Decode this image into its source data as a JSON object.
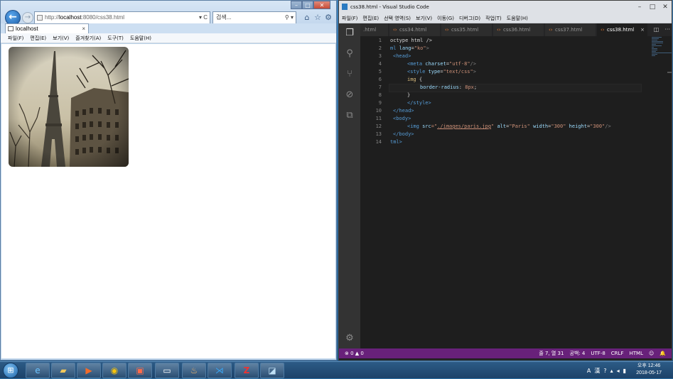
{
  "ie": {
    "address_prefix": "http://",
    "address_host": "localhost",
    "address_suffix": ":8080/css38.html",
    "address_ctrls": "▾ C",
    "search_placeholder": "검색...",
    "search_ctrls": "⚲ ▾",
    "tab_title": "localhost",
    "tab_close": "×",
    "ghost_tab": "",
    "menu": [
      "파일(F)",
      "편집(E)",
      "보기(V)",
      "즐겨찾기(A)",
      "도구(T)",
      "도움말(H)"
    ],
    "image_alt": "Paris"
  },
  "vscode": {
    "title": "css38.html - Visual Studio Code",
    "menu": [
      "파일(F)",
      "편집(E)",
      "선택 영역(S)",
      "보기(V)",
      "이동(G)",
      "디버그(D)",
      "작업(T)",
      "도움말(H)"
    ],
    "tabs": [
      {
        "label": ".html",
        "active": false
      },
      {
        "label": "css34.html",
        "active": false
      },
      {
        "label": "css35.html",
        "active": false
      },
      {
        "label": "css36.html",
        "active": false
      },
      {
        "label": "css37.html",
        "active": false
      },
      {
        "label": "css38.html",
        "active": true
      }
    ],
    "tab_close": "×",
    "line_numbers": [
      "1",
      "2",
      "3",
      "4",
      "5",
      "6",
      "7",
      "8",
      "9",
      "10",
      "11",
      "12",
      "13",
      "14"
    ],
    "status_left": "⊗ 0 ▲ 0",
    "status_right": [
      "줄 7, 열 31",
      "공백: 4",
      "UTF-8",
      "CRLF",
      "HTML",
      "☺",
      "🔔"
    ]
  },
  "code": {
    "l1": "octype html />",
    "l2a": "ml ",
    "l2b": "lang",
    "l2c": "=",
    "l2d": "\"ko\"",
    "l2e": ">",
    "l3": "<head>",
    "l4a": "<meta ",
    "l4b": "charset",
    "l4c": "=",
    "l4d": "\"utf-8\"",
    "l4e": "/>",
    "l5a": "<style ",
    "l5b": "type",
    "l5c": "=",
    "l5d": "\"text/css\"",
    "l5e": ">",
    "l6a": "img",
    "l6b": " {",
    "l7a": "border-radius",
    "l7b": ": ",
    "l7c": "8px",
    "l7d": ";",
    "l8": "}",
    "l9": "</style>",
    "l10": "</head>",
    "l11": "<body>",
    "l12a": "<img ",
    "l12b": "src",
    "l12c": "=\"",
    "l12d": "./images/paris.jpg",
    "l12e": "\" ",
    "l12f": "alt",
    "l12g": "=",
    "l12h": "\"Paris\" ",
    "l12i": "width",
    "l12j": "=",
    "l12k": "\"300\" ",
    "l12l": "height",
    "l12m": "=",
    "l12n": "\"300\"",
    "l12o": "/>",
    "l13": "</body>",
    "l14": "tml>"
  },
  "taskbar": {
    "clock_time": "오후 12:46",
    "clock_date": "2018-05-17",
    "tray": [
      "A",
      "漢",
      "?",
      "▴",
      "◂",
      "▮"
    ]
  }
}
